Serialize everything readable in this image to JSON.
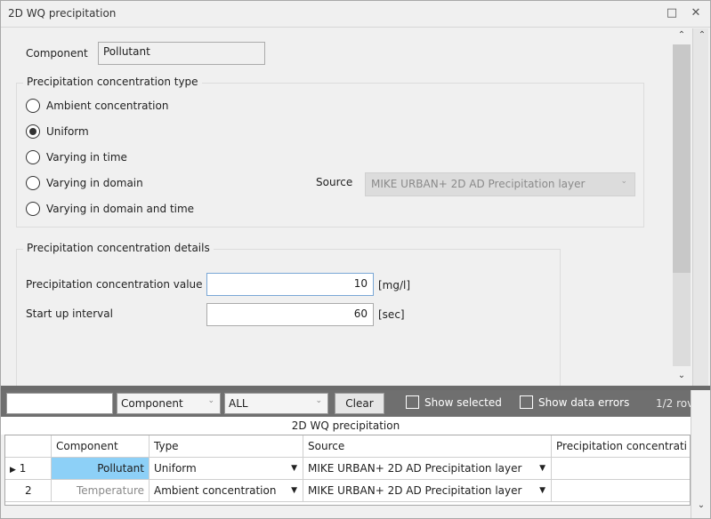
{
  "window": {
    "title": "2D WQ precipitation",
    "restore_icon": "restore-icon",
    "close_icon": "close-icon"
  },
  "component": {
    "label": "Component",
    "value": "Pollutant"
  },
  "concentration_type": {
    "title": "Precipitation concentration type",
    "options": [
      {
        "label": "Ambient concentration",
        "checked": false
      },
      {
        "label": "Uniform",
        "checked": true
      },
      {
        "label": "Varying in time",
        "checked": false
      },
      {
        "label": "Varying in domain",
        "checked": false
      },
      {
        "label": "Varying in domain and time",
        "checked": false
      }
    ],
    "source_label": "Source",
    "source_value": "MIKE URBAN+ 2D AD Precipitation layer"
  },
  "details": {
    "title": "Precipitation concentration details",
    "value_label": "Precipitation concentration value",
    "value": "10",
    "value_unit": "[mg/l]",
    "interval_label": "Start up  interval",
    "interval": "60",
    "interval_unit": "[sec]"
  },
  "filter": {
    "search_value": "",
    "field_combo": "Component",
    "value_combo": "ALL",
    "clear_label": "Clear",
    "show_selected_label": "Show selected",
    "show_errors_label": "Show data errors",
    "row_count": "1/2 rov"
  },
  "grid": {
    "title": "2D WQ precipitation",
    "columns": [
      "",
      "Component",
      "Type",
      "Source",
      "Precipitation concentrati"
    ],
    "rows": [
      {
        "index": "1",
        "component": "Pollutant",
        "type": "Uniform",
        "source": "MIKE URBAN+ 2D AD Precipitation layer",
        "value": ""
      },
      {
        "index": "2",
        "component": "Temperature",
        "type": "Ambient concentration",
        "source": "MIKE URBAN+ 2D AD Precipitation layer",
        "value": ""
      }
    ]
  },
  "colors": {
    "selected_cell": "#8dd0f7",
    "filterbar": "#6f6f6f"
  }
}
